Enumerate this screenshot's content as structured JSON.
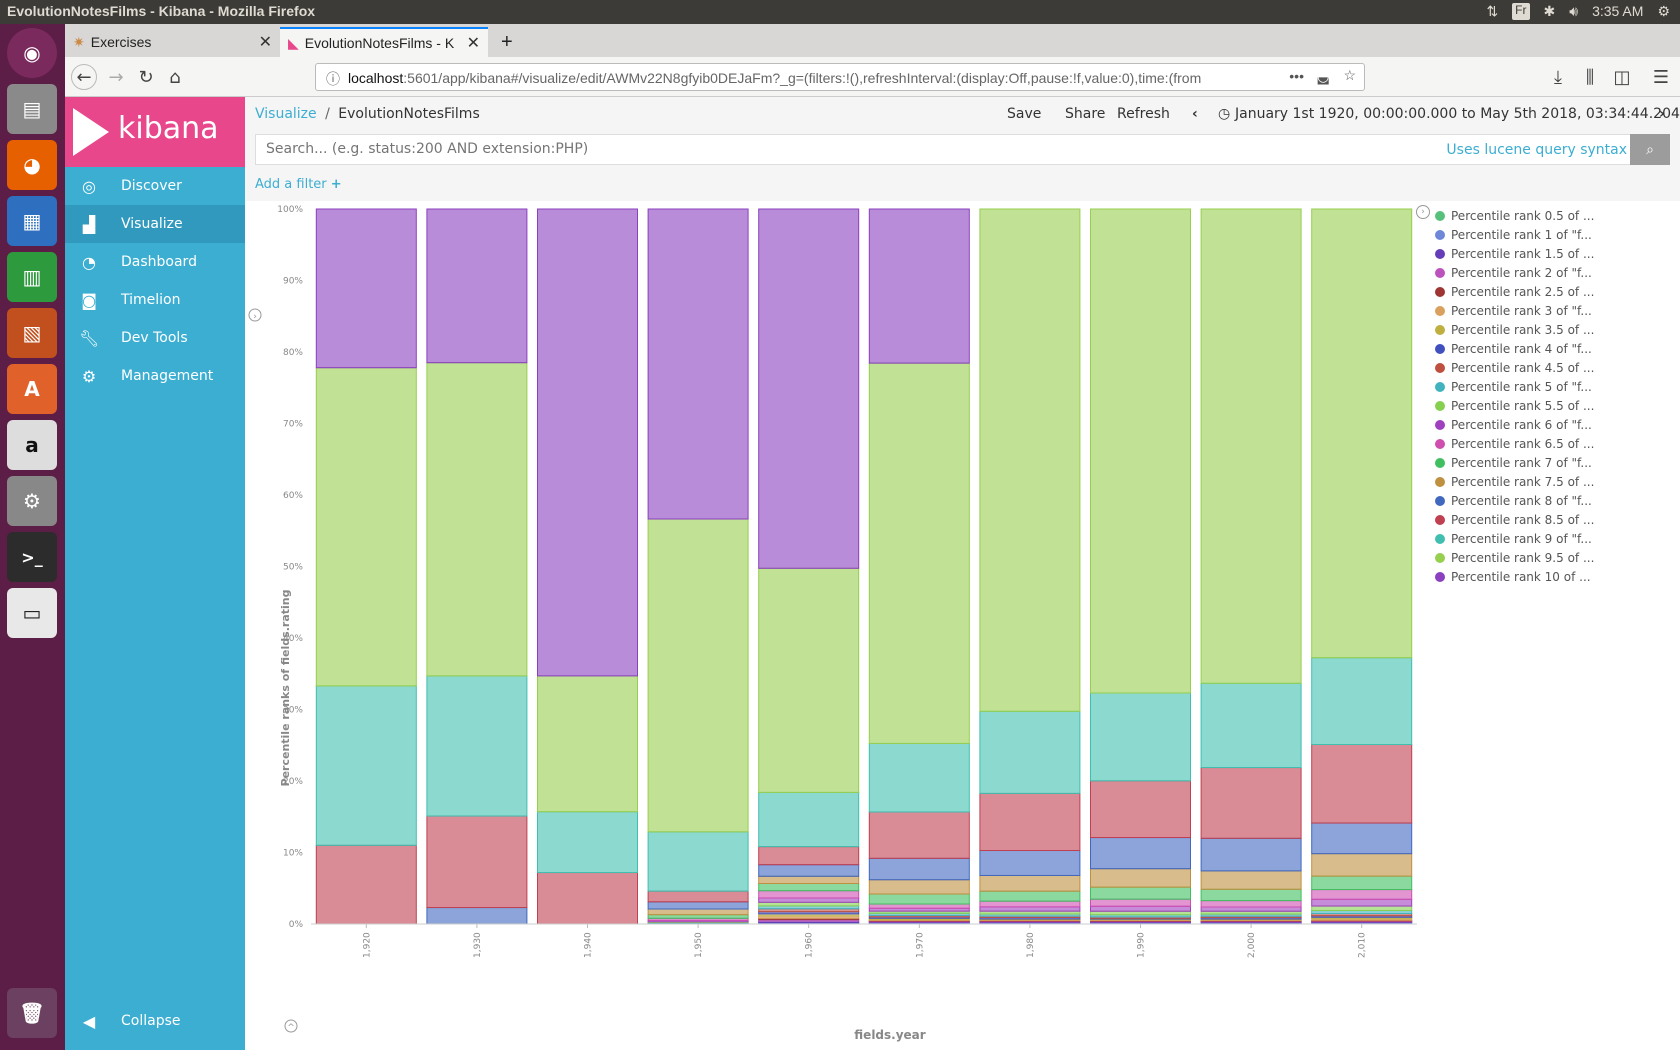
{
  "os": {
    "window_title": "EvolutionNotesFilms - Kibana - Mozilla Firefox",
    "keyboard_layout": "Fr",
    "clock": "3:35 AM"
  },
  "browser": {
    "tabs": [
      {
        "label": "Exercises"
      },
      {
        "label": "EvolutionNotesFilms - K"
      }
    ],
    "url_host": "localhost",
    "url_rest": ":5601/app/kibana#/visualize/edit/AWMv22N8gfyib0DEJaFm?_g=(filters:!(),refreshInterval:(display:Off,pause:!f,value:0),time:(from"
  },
  "sidebar": {
    "brand": "kibana",
    "items": [
      {
        "label": "Discover",
        "icon": "compass-icon"
      },
      {
        "label": "Visualize",
        "icon": "bar-chart-icon"
      },
      {
        "label": "Dashboard",
        "icon": "dashboard-icon"
      },
      {
        "label": "Timelion",
        "icon": "timelion-icon"
      },
      {
        "label": "Dev Tools",
        "icon": "wrench-icon"
      },
      {
        "label": "Management",
        "icon": "gear-icon"
      }
    ],
    "collapse": "Collapse",
    "accent": "#3caed2",
    "brand_color": "#e8488b"
  },
  "toolbar": {
    "breadcrumb_root": "Visualize",
    "breadcrumb_sep": "/",
    "breadcrumb_current": "EvolutionNotesFilms",
    "save": "Save",
    "share": "Share",
    "refresh": "Refresh",
    "time_range": "January 1st 1920, 00:00:00.000 to May 5th 2018, 03:34:44.204"
  },
  "search": {
    "placeholder": "Search... (e.g. status:200 AND extension:PHP)",
    "lucene_link": "Uses lucene query syntax"
  },
  "filter": {
    "add_label": "Add a filter"
  },
  "chart_data": {
    "type": "bar",
    "stacked": "percent",
    "xlabel": "fields.year",
    "ylabel": "Percentile ranks of fields.rating",
    "categories": [
      "1,920",
      "1,930",
      "1,940",
      "1,950",
      "1,960",
      "1,970",
      "1,980",
      "1,990",
      "2,000",
      "2,010"
    ],
    "ylim": [
      0,
      100
    ],
    "yticks": [
      "0%",
      "10%",
      "20%",
      "30%",
      "40%",
      "50%",
      "60%",
      "70%",
      "80%",
      "90%",
      "100%"
    ],
    "legend_position": "right",
    "series": [
      {
        "name": "Percentile rank 0.5 of ...",
        "color": "#57c17b",
        "values": [
          0,
          0,
          0,
          0,
          0.1,
          0.1,
          0.1,
          0.1,
          0.1,
          0.1
        ]
      },
      {
        "name": "Percentile rank 1 of \"f...",
        "color": "#6f87d8",
        "values": [
          0,
          0,
          0,
          0,
          0.1,
          0.1,
          0.1,
          0.1,
          0.1,
          0.1
        ]
      },
      {
        "name": "Percentile rank 1.5 of ...",
        "color": "#663db8",
        "values": [
          0,
          0,
          0,
          0,
          0.2,
          0.1,
          0.1,
          0.1,
          0.1,
          0.1
        ]
      },
      {
        "name": "Percentile rank 2 of \"f...",
        "color": "#bc52bc",
        "values": [
          0,
          0,
          0,
          0,
          0.2,
          0.1,
          0.1,
          0.1,
          0.1,
          0.1
        ]
      },
      {
        "name": "Percentile rank 2.5 of ...",
        "color": "#9e3533",
        "values": [
          0,
          0,
          0,
          0,
          0.2,
          0.1,
          0.1,
          0.1,
          0.1,
          0.1
        ]
      },
      {
        "name": "Percentile rank 3 of \"f...",
        "color": "#daa05d",
        "values": [
          0,
          0,
          0,
          0,
          0.3,
          0.1,
          0.1,
          0.1,
          0.1,
          0.2
        ]
      },
      {
        "name": "Percentile rank 3.5 of ...",
        "color": "#bfaf40",
        "values": [
          0,
          0,
          0,
          0,
          0.3,
          0.2,
          0.1,
          0.1,
          0.1,
          0.2
        ]
      },
      {
        "name": "Percentile rank 4 of \"f...",
        "color": "#4050bf",
        "values": [
          0,
          0,
          0,
          0,
          0.3,
          0.2,
          0.2,
          0.1,
          0.2,
          0.2
        ]
      },
      {
        "name": "Percentile rank 4.5 of ...",
        "color": "#bf5040",
        "values": [
          0,
          0,
          0,
          0.1,
          0.4,
          0.2,
          0.2,
          0.2,
          0.2,
          0.3
        ]
      },
      {
        "name": "Percentile rank 5 of \"f...",
        "color": "#40b3bf",
        "values": [
          0,
          0,
          0,
          0.1,
          0.4,
          0.3,
          0.3,
          0.3,
          0.3,
          0.4
        ]
      },
      {
        "name": "Percentile rank 5.5 of ...",
        "color": "#86cf4f",
        "values": [
          0,
          0,
          0,
          0.1,
          0.5,
          0.3,
          0.4,
          0.5,
          0.4,
          0.6
        ]
      },
      {
        "name": "Percentile rank 6 of \"f...",
        "color": "#a040bf",
        "values": [
          0,
          0,
          0,
          0.2,
          0.6,
          0.4,
          0.6,
          0.7,
          0.6,
          0.9
        ]
      },
      {
        "name": "Percentile rank 6.5 of ...",
        "color": "#cf4fb0",
        "values": [
          0,
          0,
          0,
          0.3,
          1.0,
          0.6,
          0.8,
          1.0,
          0.9,
          1.3
        ]
      },
      {
        "name": "Percentile rank 7 of \"f...",
        "color": "#40bf60",
        "values": [
          0,
          0,
          0,
          0.5,
          1.0,
          1.4,
          1.4,
          1.7,
          1.6,
          1.8
        ]
      },
      {
        "name": "Percentile rank 7.5 of ...",
        "color": "#bf9040",
        "values": [
          0,
          0,
          0,
          0.8,
          1.0,
          2.0,
          2.2,
          2.6,
          2.6,
          3.0
        ]
      },
      {
        "name": "Percentile rank 8 of \"f...",
        "color": "#4068bf",
        "values": [
          0,
          2.3,
          0,
          1.0,
          1.6,
          3.0,
          3.5,
          4.4,
          4.6,
          4.1
        ]
      },
      {
        "name": "Percentile rank 8.5 of ...",
        "color": "#bf4050",
        "values": [
          11.0,
          12.8,
          7.2,
          1.5,
          2.5,
          6.5,
          8.0,
          8.0,
          10.0,
          10.5
        ]
      },
      {
        "name": "Percentile rank 9 of \"f...",
        "color": "#40bfb0",
        "values": [
          22.3,
          19.6,
          8.5,
          8.3,
          7.5,
          9.6,
          11.5,
          12.4,
          11.9,
          11.6
        ]
      },
      {
        "name": "Percentile rank 9.5 of ...",
        "color": "#97cf4f",
        "values": [
          44.5,
          43.8,
          19.0,
          43.8,
          31.0,
          53.3,
          70.4,
          68.3,
          67.0,
          60.0
        ]
      },
      {
        "name": "Percentile rank 10 of ...",
        "color": "#8a40bf",
        "values": [
          22.2,
          21.5,
          65.3,
          43.4,
          49.7,
          21.6,
          0,
          0,
          0,
          0
        ]
      }
    ]
  }
}
